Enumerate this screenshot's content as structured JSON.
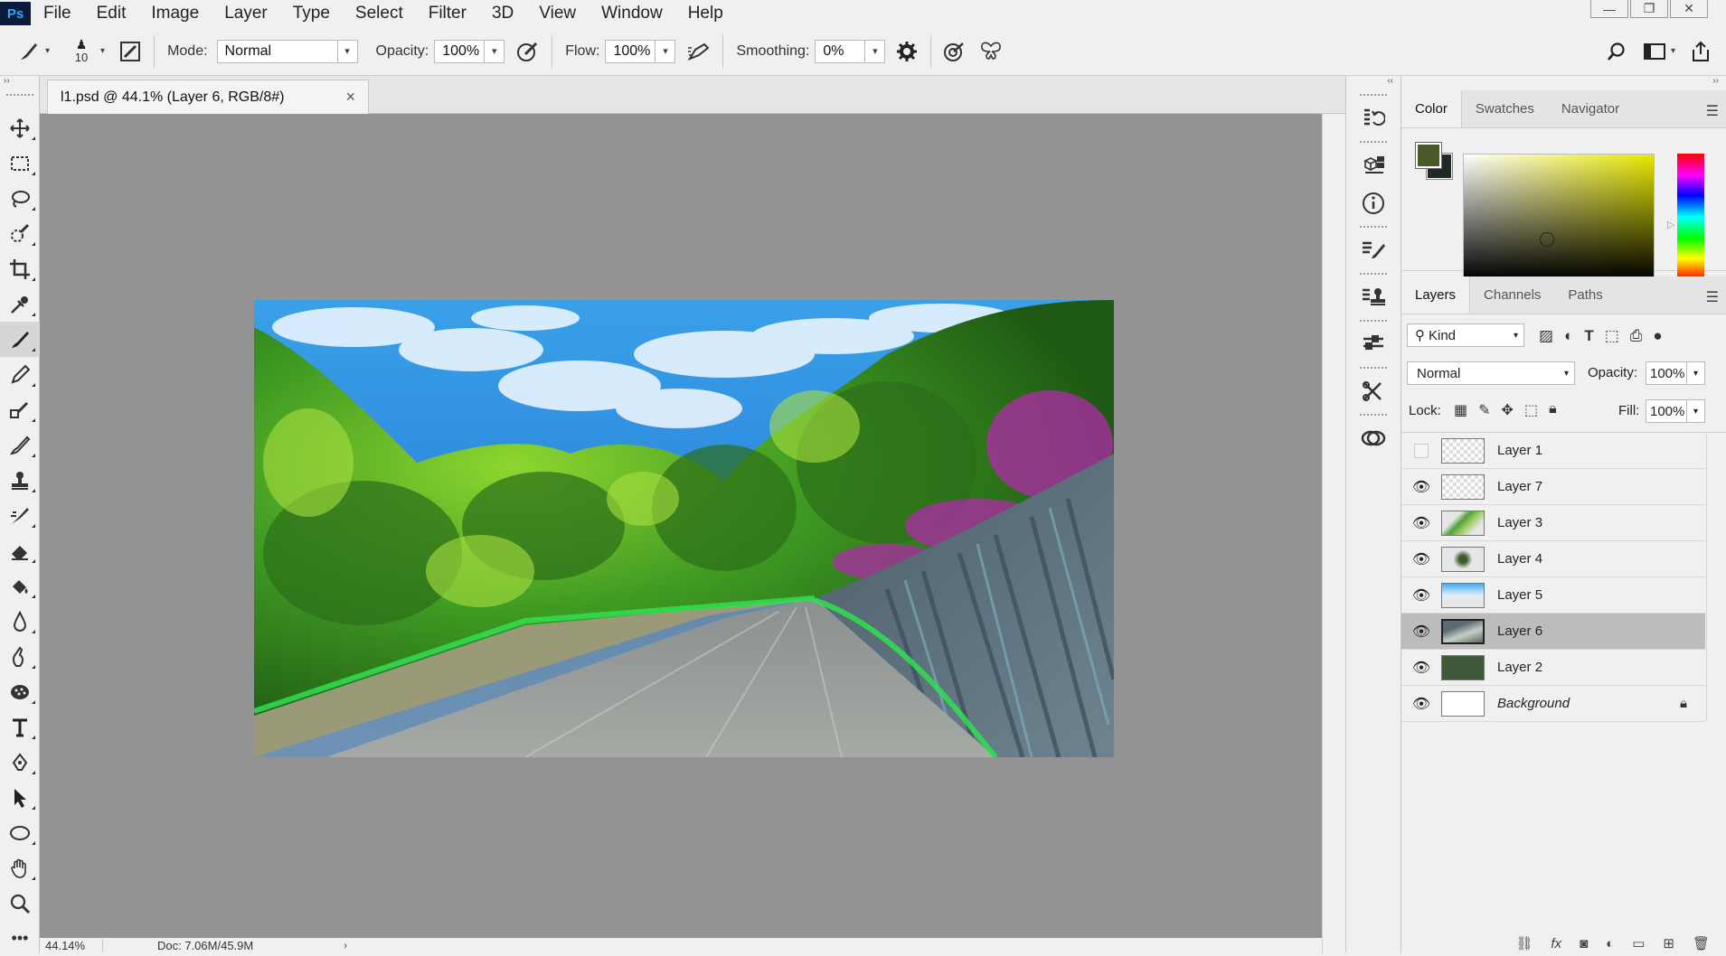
{
  "app": {
    "logo": "Ps"
  },
  "menu": [
    "File",
    "Edit",
    "Image",
    "Layer",
    "Type",
    "Select",
    "Filter",
    "3D",
    "View",
    "Window",
    "Help"
  ],
  "window_controls": {
    "minimize": "—",
    "restore": "❐",
    "close": "✕"
  },
  "options": {
    "brush_size": "10",
    "mode_label": "Mode:",
    "mode_value": "Normal",
    "opacity_label": "Opacity:",
    "opacity_value": "100%",
    "flow_label": "Flow:",
    "flow_value": "100%",
    "smoothing_label": "Smoothing:",
    "smoothing_value": "0%"
  },
  "document": {
    "tab_title": "l1.psd @ 44.1% (Layer 6, RGB/8#)",
    "tab_close": "×",
    "zoom_status": "44.14%",
    "doc_status": "Doc: 7.06M/45.9M"
  },
  "color_panel": {
    "tabs": [
      "Color",
      "Swatches",
      "Navigator"
    ],
    "foreground": "#4a5a2a",
    "background": "#1f2a28",
    "field_hue": "#e8e800"
  },
  "layers_panel": {
    "tabs": [
      "Layers",
      "Channels",
      "Paths"
    ],
    "filter_label": "Kind",
    "blend_mode": "Normal",
    "opacity_label": "Opacity:",
    "opacity_value": "100%",
    "lock_label": "Lock:",
    "fill_label": "Fill:",
    "fill_value": "100%",
    "layers": [
      {
        "name": "Layer 1",
        "visible": false,
        "selected": false
      },
      {
        "name": "Layer 7",
        "visible": true,
        "selected": false
      },
      {
        "name": "Layer 3",
        "visible": true,
        "selected": false
      },
      {
        "name": "Layer 4",
        "visible": true,
        "selected": false
      },
      {
        "name": "Layer 5",
        "visible": true,
        "selected": false
      },
      {
        "name": "Layer 6",
        "visible": true,
        "selected": true
      },
      {
        "name": "Layer 2",
        "visible": true,
        "selected": false
      },
      {
        "name": "Background",
        "visible": true,
        "selected": false,
        "locked": true
      }
    ],
    "footer_icons": [
      "link-icon",
      "fx-icon",
      "mask-icon",
      "adjustment-icon",
      "folder-icon",
      "new-layer-icon",
      "trash-icon"
    ]
  },
  "colors": {
    "ui_bg": "#f0f0f0",
    "canvas_bg": "#939393",
    "selected_row": "#bcbcbc"
  }
}
